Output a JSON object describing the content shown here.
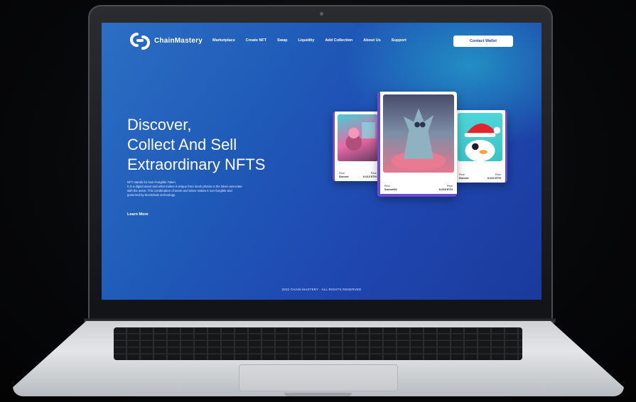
{
  "brand": {
    "name": "ChainMastery"
  },
  "nav": {
    "items": [
      "Marketplace",
      "Create NFT",
      "Swap",
      "Liquidity",
      "Add Collection",
      "About Us",
      "Support"
    ],
    "contact_label": "Contact Wallet"
  },
  "hero": {
    "title_line1": "Discover,",
    "title_line2": "Collect And Sell",
    "title_line3": "Extraordinary NFTS",
    "desc_line1": "NFT stands for Non-Fungible Token.",
    "desc_line2": "It is a digital asset and what makes it unique from stock photos is the token associate",
    "desc_line3": "with the asset. This combination of asset and token makes it non-fungible and",
    "desc_line4": "governed by blockchain technology.",
    "learn_more": "Learn More"
  },
  "cards": {
    "left": {
      "label": "Price",
      "name": "Sonnet",
      "price_label": "Price",
      "price": "0.013 ETH"
    },
    "center": {
      "label": "Price",
      "name": "Sonnet01",
      "price_label": "Price",
      "price": "0.033 ETH"
    },
    "right": {
      "label": "Price",
      "name": "Sonnet",
      "price_label": "Price",
      "price": "0.013 ETH"
    }
  },
  "footer": {
    "text": "2022 CHAIN MASTERY · ALL RIGHTS RESERVED"
  },
  "colors": {
    "accent": "#1f47b0",
    "teal": "#24c8d2",
    "card_border": "#6a4cd1"
  }
}
